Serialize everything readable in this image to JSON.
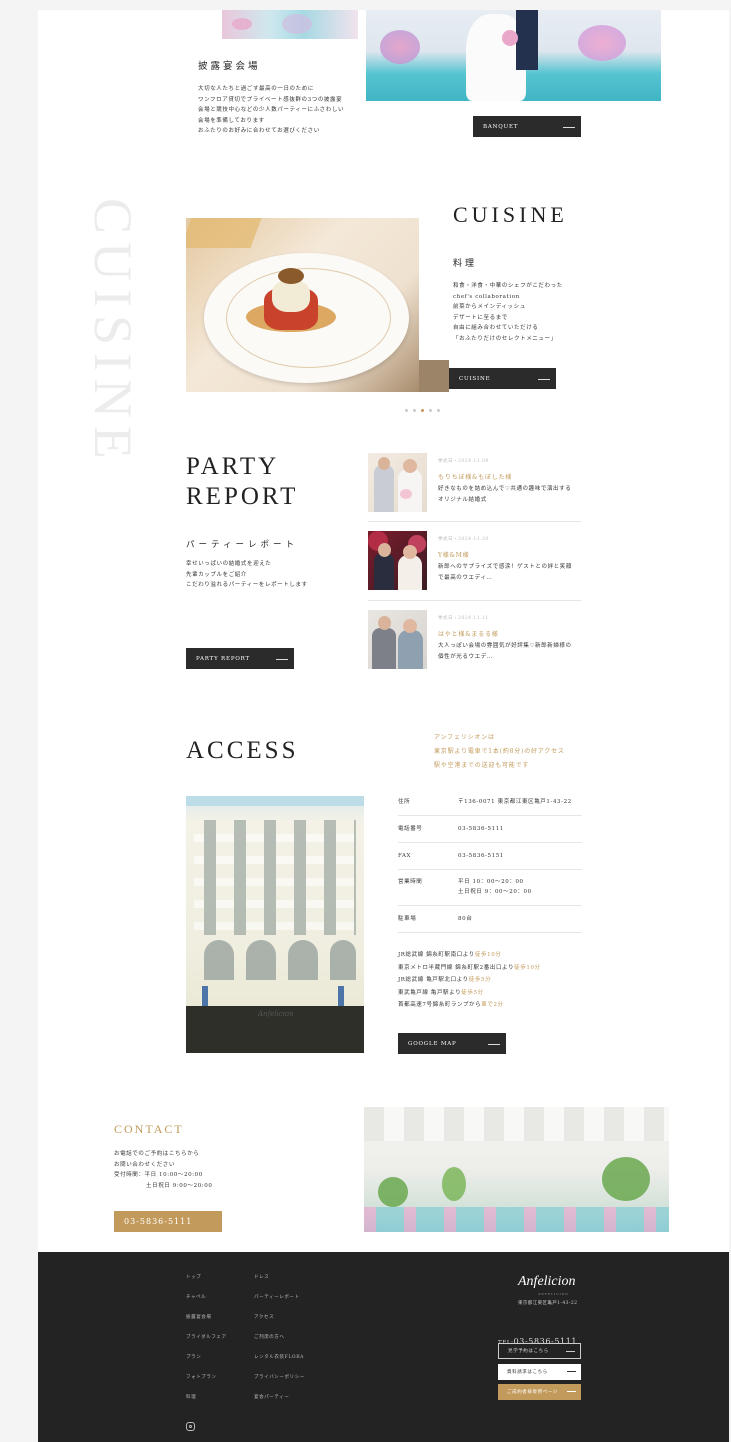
{
  "banquet": {
    "heading": "披露宴会場",
    "lines": [
      "大切な人たちと過ごす最高の一日のために",
      "ワンフロア貸切でプライベート感抜群の3つの披露宴",
      "会場と競技中心などの少人数パーティーにふさわしい",
      "会場を準備しております",
      "おふたりのお好みに合わせてお選びください"
    ],
    "button": "BANQUET"
  },
  "cuisine": {
    "vertical": "CUISINE",
    "title": "CUISINE",
    "subtitle": "料理",
    "lines": [
      "和食・洋食・中華のシェフがこだわった",
      "chef's collaboration",
      "前菜からメインディッシュ",
      "デザートに至るまで",
      "自由に組み合わせていただける",
      "「おふたりだけのセレクトメニュー」"
    ],
    "button": "CUISINE"
  },
  "party": {
    "title_1": "PARTY",
    "title_2": "REPORT",
    "subtitle": "パーティーレポート",
    "lines": [
      "幸せいっぱいの結婚式を迎えた",
      "先輩カップルをご紹介",
      "こだわり溢れるパーティーをレポートします"
    ],
    "button": "PARTY REPORT",
    "items": [
      {
        "date": "挙式日・2024.11.09",
        "title": "もりちぼ様&もぼした様",
        "desc_1": "好きなものを詰め込んで♡共通の趣味で演出する",
        "desc_2": "オリジナル結婚式"
      },
      {
        "date": "挙式日・2024.11.20",
        "title": "Y様&M様",
        "desc_1": "新郎へのサプライズで感涙！ゲストとの絆と笑顔",
        "desc_2": "で最高のウエディ…"
      },
      {
        "date": "挙式日・2024.11.11",
        "title": "はやと様&まるる様",
        "desc_1": "大人っぽい会場の雰囲気が好評集♡新郎新婦様の",
        "desc_2": "個性が光るウエデ…"
      }
    ]
  },
  "access": {
    "title": "ACCESS",
    "tagline_1": "アンフェリシオンは",
    "tagline_2": "東京駅より電車で1本(約8分)の好アクセス",
    "tagline_3": "駅や空港までの送迎も可能です",
    "rows": [
      {
        "label": "住所",
        "value": "〒136-0071 東京都江東区亀戸1-43-22",
        "value2": ""
      },
      {
        "label": "電話番号",
        "value": "03-5836-5111",
        "value2": ""
      },
      {
        "label": "FAX",
        "value": "03-5836-5151",
        "value2": ""
      },
      {
        "label": "営業時間",
        "value": "平日 10：00〜20：00",
        "value2": "土日祝日 9：00〜20：00"
      },
      {
        "label": "駐車場",
        "value": "80台",
        "value2": ""
      }
    ],
    "routes": [
      {
        "text": "JR総武線 錦糸町駅南口より",
        "time": "徒歩10分"
      },
      {
        "text": "東京メトロ半蔵門線 錦糸町駅2番出口より",
        "time": "徒歩10分"
      },
      {
        "text": "JR総武線 亀戸駅北口より",
        "time": "徒歩5分"
      },
      {
        "text": "東武亀戸線 亀戸駅より",
        "time": "徒歩5分"
      },
      {
        "text": "首都高速7号錦糸町ランプから",
        "time": "車で2分"
      }
    ],
    "button": "GOOGLE MAP",
    "building_sign": "Anfelicion"
  },
  "contact": {
    "title": "CONTACT",
    "line_1": "お電話でのご予約はこちらから",
    "line_2": "お問い合わせください",
    "line_3": "受付時間：平日 10:00〜20:00",
    "line_4": "土日祝日 9:00〜20:00",
    "phone_button": "03-5836-5111"
  },
  "footer": {
    "col1": [
      "トップ",
      "チャペル",
      "披露宴会場",
      "ブライダルフェア",
      "プラン",
      "フォトプラン",
      "料理"
    ],
    "col2": [
      "ドレス",
      "パーティーレポート",
      "アクセス",
      "ご列席の方へ",
      "レンタル衣装FLORA",
      "プライバシーポリシー",
      "宴会パーティー"
    ],
    "logo": "Anfelicion",
    "logo_sub": "ANFELICION",
    "address": "東京都江東区亀戸1-43-22",
    "tel_label": "TEL:",
    "tel": "03-5836-5111",
    "buttons": [
      "見学予約はこちら",
      "資料請求はこちら",
      "ご成約者様専用ページ"
    ]
  },
  "colors": {
    "gold": "#c29a5b",
    "dark": "#2b2b2b",
    "footer": "#232323"
  }
}
